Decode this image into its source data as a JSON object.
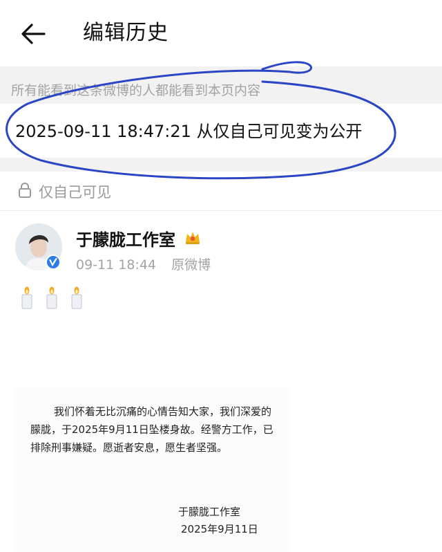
{
  "header": {
    "title": "编辑历史"
  },
  "notice": "所有能看到这条微博的人都能看到本页内容",
  "history_entry": "2025-09-11 18:47:21 从仅自己可见变为公开",
  "visibility": {
    "label": "仅自己可见"
  },
  "post": {
    "author": "于朦胧工作室",
    "time": "09-11 18:44",
    "source": "原微博",
    "emoji": [
      "candle-emoji",
      "candle-emoji",
      "candle-emoji"
    ],
    "statement": "我们怀着无比沉痛的心情告知大家，我们深爱的朦胧，于2025年9月11日坠楼身故。经警方工作，已排除刑事嫌疑。愿逝者安息，愿生者坚强。",
    "signature_name": "于朦胧工作室",
    "signature_date": "2025年9月11日"
  },
  "colors": {
    "annotation_ink": "#2a46c4",
    "section_gap": "#f2f2f2",
    "muted_text": "#a3a3a3",
    "crown_gold": "#f2b31b",
    "verify_blue": "#2d7be5"
  }
}
